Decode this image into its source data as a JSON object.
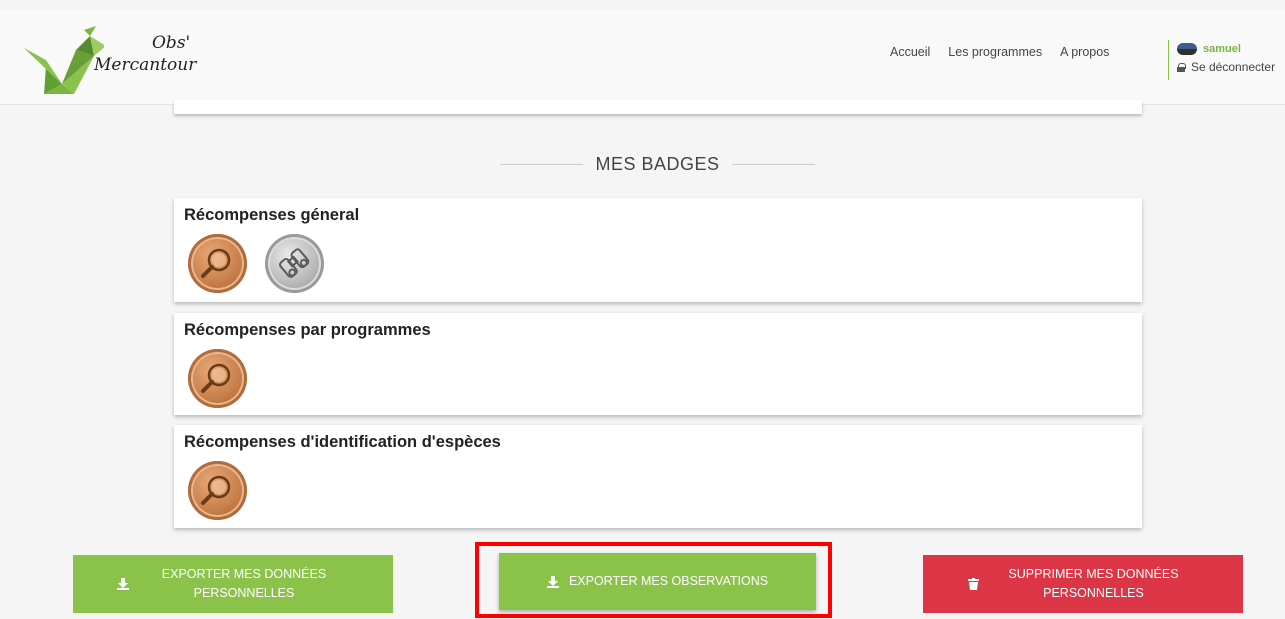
{
  "header": {
    "logo": {
      "line1": "Obs'",
      "line2": "Mercantour"
    },
    "nav": [
      {
        "label": "Accueil"
      },
      {
        "label": "Les programmes"
      },
      {
        "label": "A propos"
      }
    ],
    "user": {
      "name": "samuel",
      "logout_label": "Se déconnecter"
    }
  },
  "section": {
    "title": "MES BADGES"
  },
  "cards": [
    {
      "title": "Récompenses géneral",
      "badges": [
        "bronze-magnifier",
        "silver-binoculars"
      ]
    },
    {
      "title": "Récompenses par programmes",
      "badges": [
        "bronze-magnifier"
      ]
    },
    {
      "title": "Récompenses d'identification d'espèces",
      "badges": [
        "bronze-magnifier"
      ]
    }
  ],
  "buttons": {
    "export_personal": "EXPORTER MES DONNÉES PERSONNELLES",
    "export_observations": "EXPORTER MES OBSERVATIONS",
    "delete_personal": "SUPPRIMER MES DONNÉES PERSONNELLES"
  },
  "colors": {
    "brand_green": "#8bc34a",
    "danger_red": "#dc3545",
    "highlight": "#ff0000"
  }
}
